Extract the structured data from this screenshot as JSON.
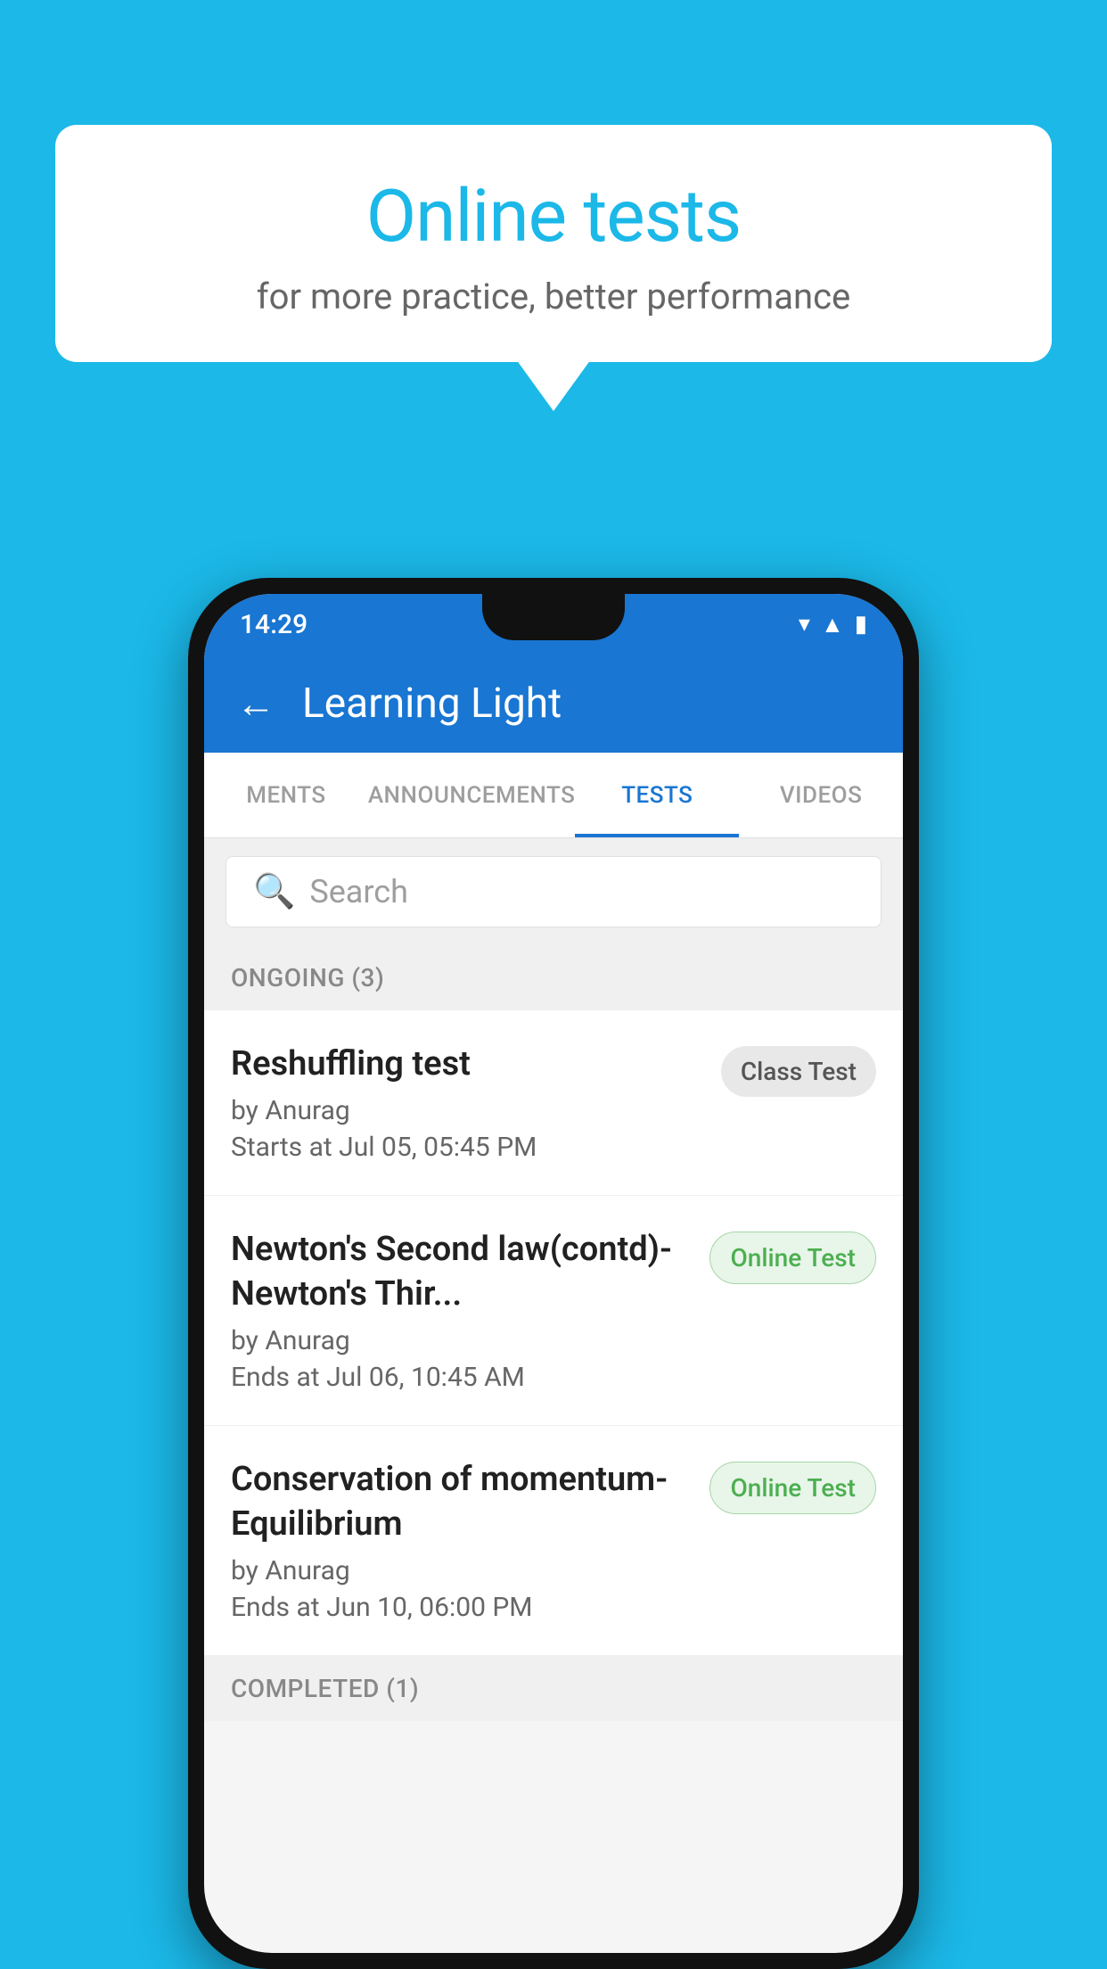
{
  "background_color": "#1bb8e8",
  "speech_bubble": {
    "title": "Online tests",
    "subtitle": "for more practice, better performance"
  },
  "phone": {
    "status_bar": {
      "time": "14:29",
      "icons": [
        "wifi",
        "signal",
        "battery"
      ]
    },
    "app_bar": {
      "title": "Learning Light",
      "back_label": "←"
    },
    "tabs": [
      {
        "label": "MENTS",
        "active": false
      },
      {
        "label": "ANNOUNCEMENTS",
        "active": false
      },
      {
        "label": "TESTS",
        "active": true
      },
      {
        "label": "VIDEOS",
        "active": false
      }
    ],
    "search": {
      "placeholder": "Search"
    },
    "ongoing_section": {
      "label": "ONGOING (3)"
    },
    "tests": [
      {
        "name": "Reshuffling test",
        "author": "by Anurag",
        "time_label": "Starts at",
        "time": "Jul 05, 05:45 PM",
        "badge": "Class Test",
        "badge_type": "class"
      },
      {
        "name": "Newton's Second law(contd)-Newton's Thir...",
        "author": "by Anurag",
        "time_label": "Ends at",
        "time": "Jul 06, 10:45 AM",
        "badge": "Online Test",
        "badge_type": "online"
      },
      {
        "name": "Conservation of momentum-Equilibrium",
        "author": "by Anurag",
        "time_label": "Ends at",
        "time": "Jun 10, 06:00 PM",
        "badge": "Online Test",
        "badge_type": "online"
      }
    ],
    "completed_section": {
      "label": "COMPLETED (1)"
    }
  }
}
